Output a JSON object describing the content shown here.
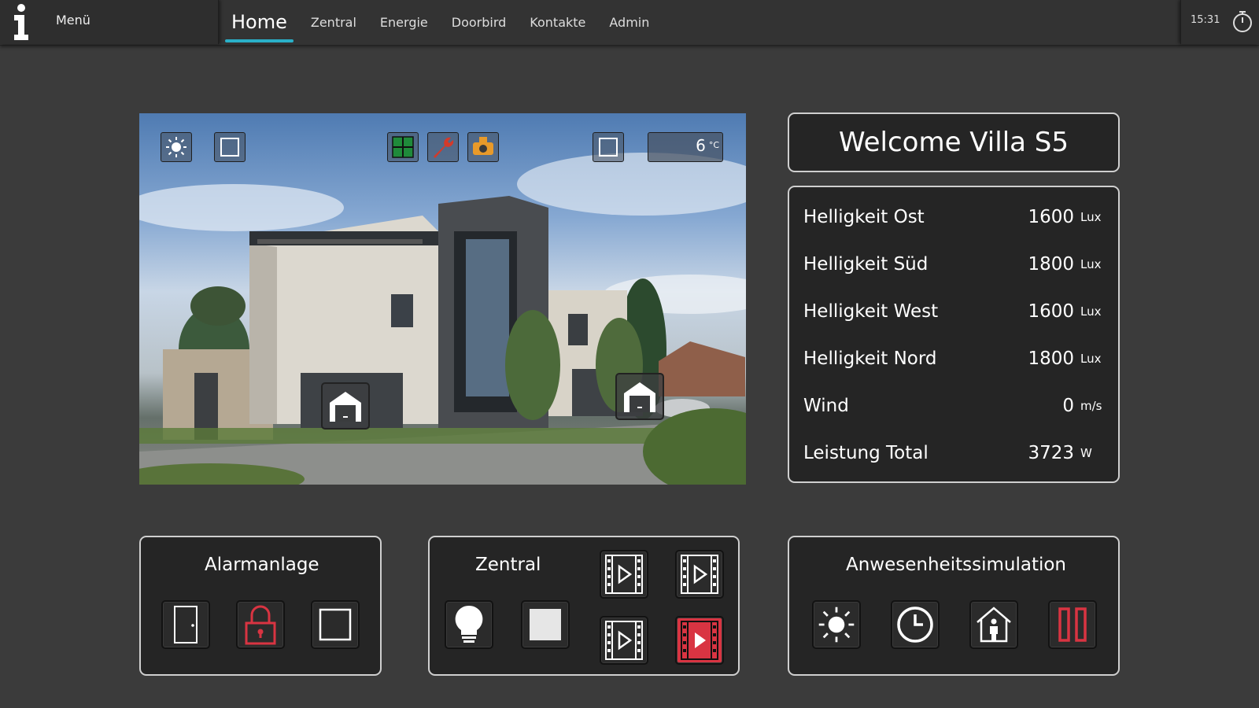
{
  "topbar": {
    "menu_label": "Menü",
    "tabs": [
      {
        "label": "Home",
        "active": true
      },
      {
        "label": "Zentral",
        "active": false
      },
      {
        "label": "Energie",
        "active": false
      },
      {
        "label": "Doorbird",
        "active": false
      },
      {
        "label": "Kontakte",
        "active": false
      },
      {
        "label": "Admin",
        "active": false
      }
    ],
    "time": "15:31"
  },
  "house": {
    "temperature": "6",
    "temperature_unit": "°C",
    "icons": [
      "sun-icon",
      "blind-square-icon",
      "window-icon",
      "wrench-icon",
      "heating-valve-icon",
      "square-icon",
      "garage-icon",
      "garage-icon"
    ]
  },
  "welcome": "Welcome Villa S5",
  "stats": [
    {
      "label": "Helligkeit Ost",
      "value": "1600",
      "unit": "Lux"
    },
    {
      "label": "Helligkeit Süd",
      "value": "1800",
      "unit": "Lux"
    },
    {
      "label": "Helligkeit West",
      "value": "1600",
      "unit": "Lux"
    },
    {
      "label": "Helligkeit Nord",
      "value": "1800",
      "unit": "Lux"
    },
    {
      "label": "Wind",
      "value": "0",
      "unit": "m/s"
    },
    {
      "label": "Leistung Total",
      "value": "3723",
      "unit": "W"
    }
  ],
  "panels": {
    "alarm": {
      "title": "Alarmanlage"
    },
    "zentral": {
      "title": "Zentral"
    },
    "presence": {
      "title": "Anwesenheitssimulation"
    }
  },
  "colors": {
    "accent": "#2ab0c8",
    "alert_red": "#d93442",
    "window_green": "#1f8a3a",
    "wrench_red": "#d33a2a",
    "valve_orange": "#e89a2a"
  }
}
